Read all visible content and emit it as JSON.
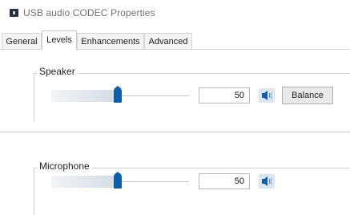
{
  "window": {
    "title": "USB audio CODEC Properties",
    "icon": "speaker-properties-icon"
  },
  "tabs": [
    {
      "label": "General",
      "active": false
    },
    {
      "label": "Levels",
      "active": true
    },
    {
      "label": "Enhancements",
      "active": false
    },
    {
      "label": "Advanced",
      "active": false
    }
  ],
  "speaker": {
    "label": "Speaker",
    "level": 0.48,
    "value": "50",
    "mute_icon": "speaker-icon",
    "balance_label": "Balance"
  },
  "microphone": {
    "label": "Microphone",
    "level": 0.48,
    "value": "50",
    "mute_icon": "speaker-icon"
  },
  "colors": {
    "accent": "#0f5ea8",
    "text": "#222222",
    "title_text": "#707070"
  }
}
